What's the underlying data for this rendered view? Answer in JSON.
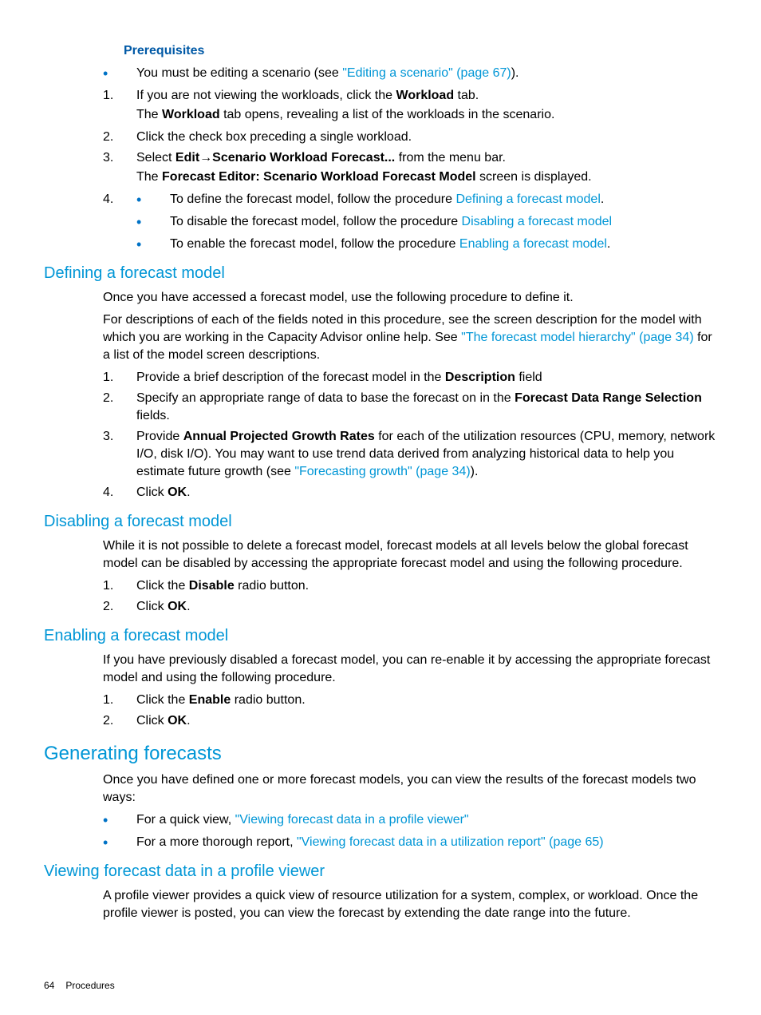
{
  "prereq": {
    "heading": "Prerequisites",
    "bullet1_pre": "You must be editing a scenario (see ",
    "bullet1_link": "\"Editing a scenario\" (page 67)",
    "bullet1_post": ")."
  },
  "steps_a": {
    "s1_line1_pre": "If you are not viewing the workloads, click the ",
    "s1_line1_b": "Workload",
    "s1_line1_post": " tab.",
    "s1_line2_pre": "The ",
    "s1_line2_b": "Workload",
    "s1_line2_post": " tab opens, revealing a list of the workloads in the scenario.",
    "s2": "Click the check box preceding a single workload.",
    "s3_line1_pre": "Select ",
    "s3_line1_b1": "Edit",
    "s3_line1_arrow": "→",
    "s3_line1_b2": "Scenario Workload Forecast...",
    "s3_line1_post": " from the menu bar.",
    "s3_line2_pre": "The ",
    "s3_line2_b": "Forecast Editor: Scenario Workload Forecast Model",
    "s3_line2_post": " screen is displayed.",
    "s4_b1_pre": "To define the forecast model, follow the procedure ",
    "s4_b1_link": "Defining a forecast model",
    "s4_b1_post": ".",
    "s4_b2_pre": "To disable the forecast model, follow the procedure ",
    "s4_b2_link": "Disabling a forecast model",
    "s4_b3_pre": "To enable the forecast model, follow the procedure ",
    "s4_b3_link": "Enabling a forecast model",
    "s4_b3_post": "."
  },
  "defining": {
    "heading": "Defining a forecast model",
    "p1": "Once you have accessed a forecast model, use the following procedure to define it.",
    "p2_pre": "For descriptions of each of the fields noted in this procedure, see the screen description for the model with which you are working in the Capacity Advisor online help. See ",
    "p2_link": "\"The forecast model hierarchy\" (page 34)",
    "p2_post": " for a list of the model screen descriptions.",
    "s1_pre": "Provide a brief description of the forecast model in the ",
    "s1_b": "Description",
    "s1_post": " field",
    "s2_pre": "Specify an appropriate range of data to base the forecast on in the ",
    "s2_b": "Forecast Data Range Selection",
    "s2_post": " fields.",
    "s3_pre": "Provide ",
    "s3_b": "Annual Projected Growth Rates",
    "s3_mid": " for each of the utilization resources (CPU, memory, network I/O, disk I/O). You may want to use trend data derived from analyzing historical data to help you estimate future growth (see ",
    "s3_link": "\"Forecasting growth\" (page 34)",
    "s3_post": ").",
    "s4_pre": "Click ",
    "s4_b": "OK",
    "s4_post": "."
  },
  "disabling": {
    "heading": "Disabling a forecast model",
    "p1": "While it is not possible to delete a forecast model, forecast models at all levels below the global forecast model can be disabled by accessing the appropriate forecast model and using the following procedure.",
    "s1_pre": "Click the ",
    "s1_b": "Disable",
    "s1_post": " radio button.",
    "s2_pre": "Click ",
    "s2_b": "OK",
    "s2_post": "."
  },
  "enabling": {
    "heading": "Enabling a forecast model",
    "p1": "If you have previously disabled a forecast model, you can re-enable it by accessing the appropriate forecast model and using the following procedure.",
    "s1_pre": "Click the ",
    "s1_b": "Enable",
    "s1_post": " radio button.",
    "s2_pre": "Click ",
    "s2_b": "OK",
    "s2_post": "."
  },
  "generating": {
    "heading": "Generating forecasts",
    "p1": "Once you have defined one or more forecast models, you can view the results of the forecast models two ways:",
    "b1_pre": "For a quick view, ",
    "b1_link": "\"Viewing forecast data in a profile viewer\"",
    "b2_pre": "For a more thorough report, ",
    "b2_link": "\"Viewing forecast data in a utilization report\" (page 65)"
  },
  "viewing": {
    "heading": "Viewing forecast data in a profile viewer",
    "p1": "A profile viewer provides a quick view of resource utilization for a system, complex, or workload. Once the profile viewer is posted, you can view the forecast by extending the date range into the future."
  },
  "footer": {
    "page": "64",
    "section": "Procedures"
  }
}
